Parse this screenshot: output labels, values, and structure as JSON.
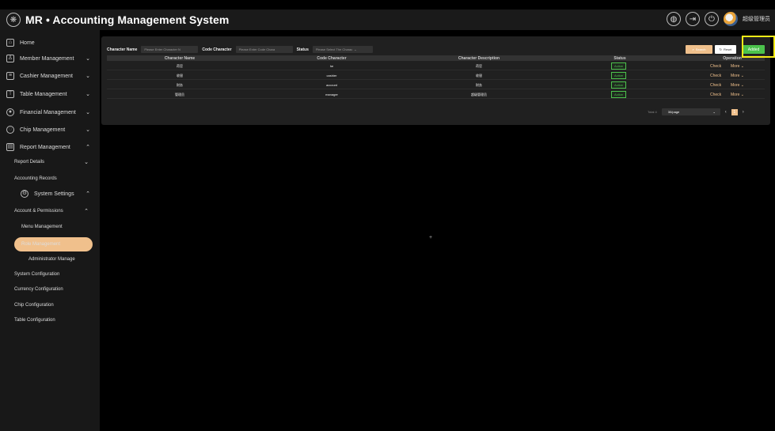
{
  "app": {
    "title": "MR • Accounting Management System",
    "user_name": "超级管理员"
  },
  "topbar_icons": [
    "globe-icon",
    "logout-icon",
    "power-icon",
    "avatar"
  ],
  "sidebar": {
    "items": [
      {
        "label": "Home",
        "icon": "home-icon"
      },
      {
        "label": "Member Management",
        "icon": "member-icon"
      },
      {
        "label": "Cashier Management",
        "icon": "cashier-icon"
      },
      {
        "label": "Table Management",
        "icon": "table-icon"
      },
      {
        "label": "Financial Management",
        "icon": "finance-icon"
      },
      {
        "label": "Chip Management",
        "icon": "chip-icon"
      },
      {
        "label": "Report Management",
        "icon": "report-icon"
      }
    ],
    "report_sub": [
      "Report Details",
      "Accounting Records"
    ],
    "system_settings": "System Settings",
    "account_permissions": "Account & Permissions",
    "account_sub": [
      "Menu Management",
      "Role Management",
      "Administrator Manage"
    ],
    "system_sub": [
      "System Configuration",
      "Currency Configuration",
      "Chip Configuration",
      "Table Configuration"
    ]
  },
  "filters": {
    "character_name_label": "Character Name",
    "character_name_placeholder": "Please Enter Character N",
    "code_character_label": "Code Character",
    "code_character_placeholder": "Please Enter Code Chara",
    "status_label": "Status",
    "status_placeholder": "Please Select The Charac"
  },
  "buttons": {
    "search": "Search",
    "reset": "Reset",
    "added": "Added"
  },
  "table": {
    "headers": [
      "Character Name",
      "Code Character",
      "Character Description",
      "Status",
      "Operation"
    ],
    "rows": [
      {
        "name": "荷官",
        "code": "he",
        "desc": "荷官",
        "status": "Active"
      },
      {
        "name": "收银",
        "code": "cashier",
        "desc": "收银",
        "status": "Active"
      },
      {
        "name": "财务",
        "code": "account",
        "desc": "财务",
        "status": "Active"
      },
      {
        "name": "管理员",
        "code": "manager",
        "desc": "超级管理员",
        "status": "Active"
      }
    ],
    "check_label": "Check",
    "more_label": "More"
  },
  "pagination": {
    "total": "Total 4",
    "page_size": "30/page",
    "current_page": "1"
  },
  "colors": {
    "accent": "#f0c08c",
    "success": "#4cc24c",
    "highlight": "#f7ec17"
  }
}
